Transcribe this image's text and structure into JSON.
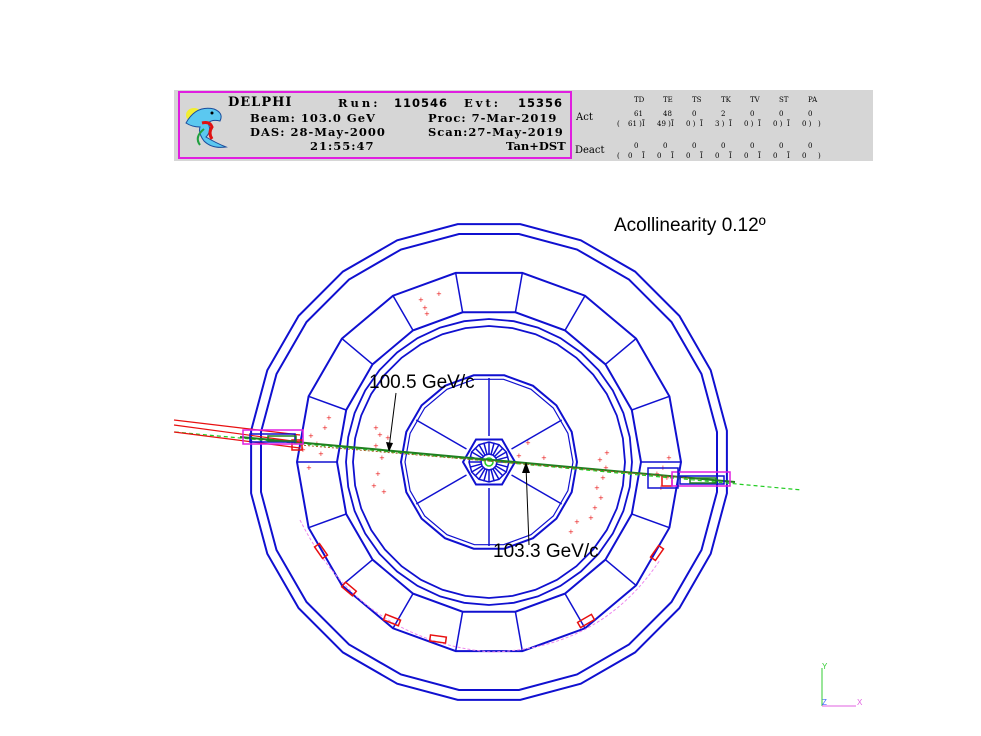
{
  "header": {
    "experiment": "DELPHI",
    "run_label": "Run:",
    "run_value": "110546",
    "evt_label": "Evt:",
    "evt_value": "15356",
    "beam": "Beam: 103.0 GeV",
    "proc": "Proc: 7-Mar-2019",
    "das": "DAS: 28-May-2000",
    "scan": "Scan:27-May-2019",
    "time": "21:55:47",
    "tag": "Tan+DST"
  },
  "status": {
    "columns": [
      "TD",
      "TE",
      "TS",
      "TK",
      "TV",
      "ST",
      "PA"
    ],
    "act_label": "Act",
    "act_values": [
      "61",
      "48",
      "0",
      "2",
      "0",
      "0",
      "0"
    ],
    "act_paren": [
      "61",
      "49",
      "0",
      "3",
      "0",
      "0",
      "0"
    ],
    "deact_label": "Deact",
    "deact_values": [
      "0",
      "0",
      "0",
      "0",
      "0",
      "0",
      "0"
    ],
    "deact_paren": [
      "0",
      "0",
      "0",
      "0",
      "0",
      "0",
      "0"
    ]
  },
  "annotations": {
    "acollinearity": "Acollinearity 0.12º",
    "track1_momentum": "100.5 GeV/c",
    "track2_momentum": "103.3 GeV/c"
  },
  "axes": {
    "y": "Y",
    "z": "Z",
    "x": "X"
  },
  "colors": {
    "detector": "#1010d0",
    "hits": "#e81010",
    "beamline": "#22cc22",
    "track": "#208020",
    "frame": "#e01ee0",
    "panel": "#d6d6d6"
  }
}
